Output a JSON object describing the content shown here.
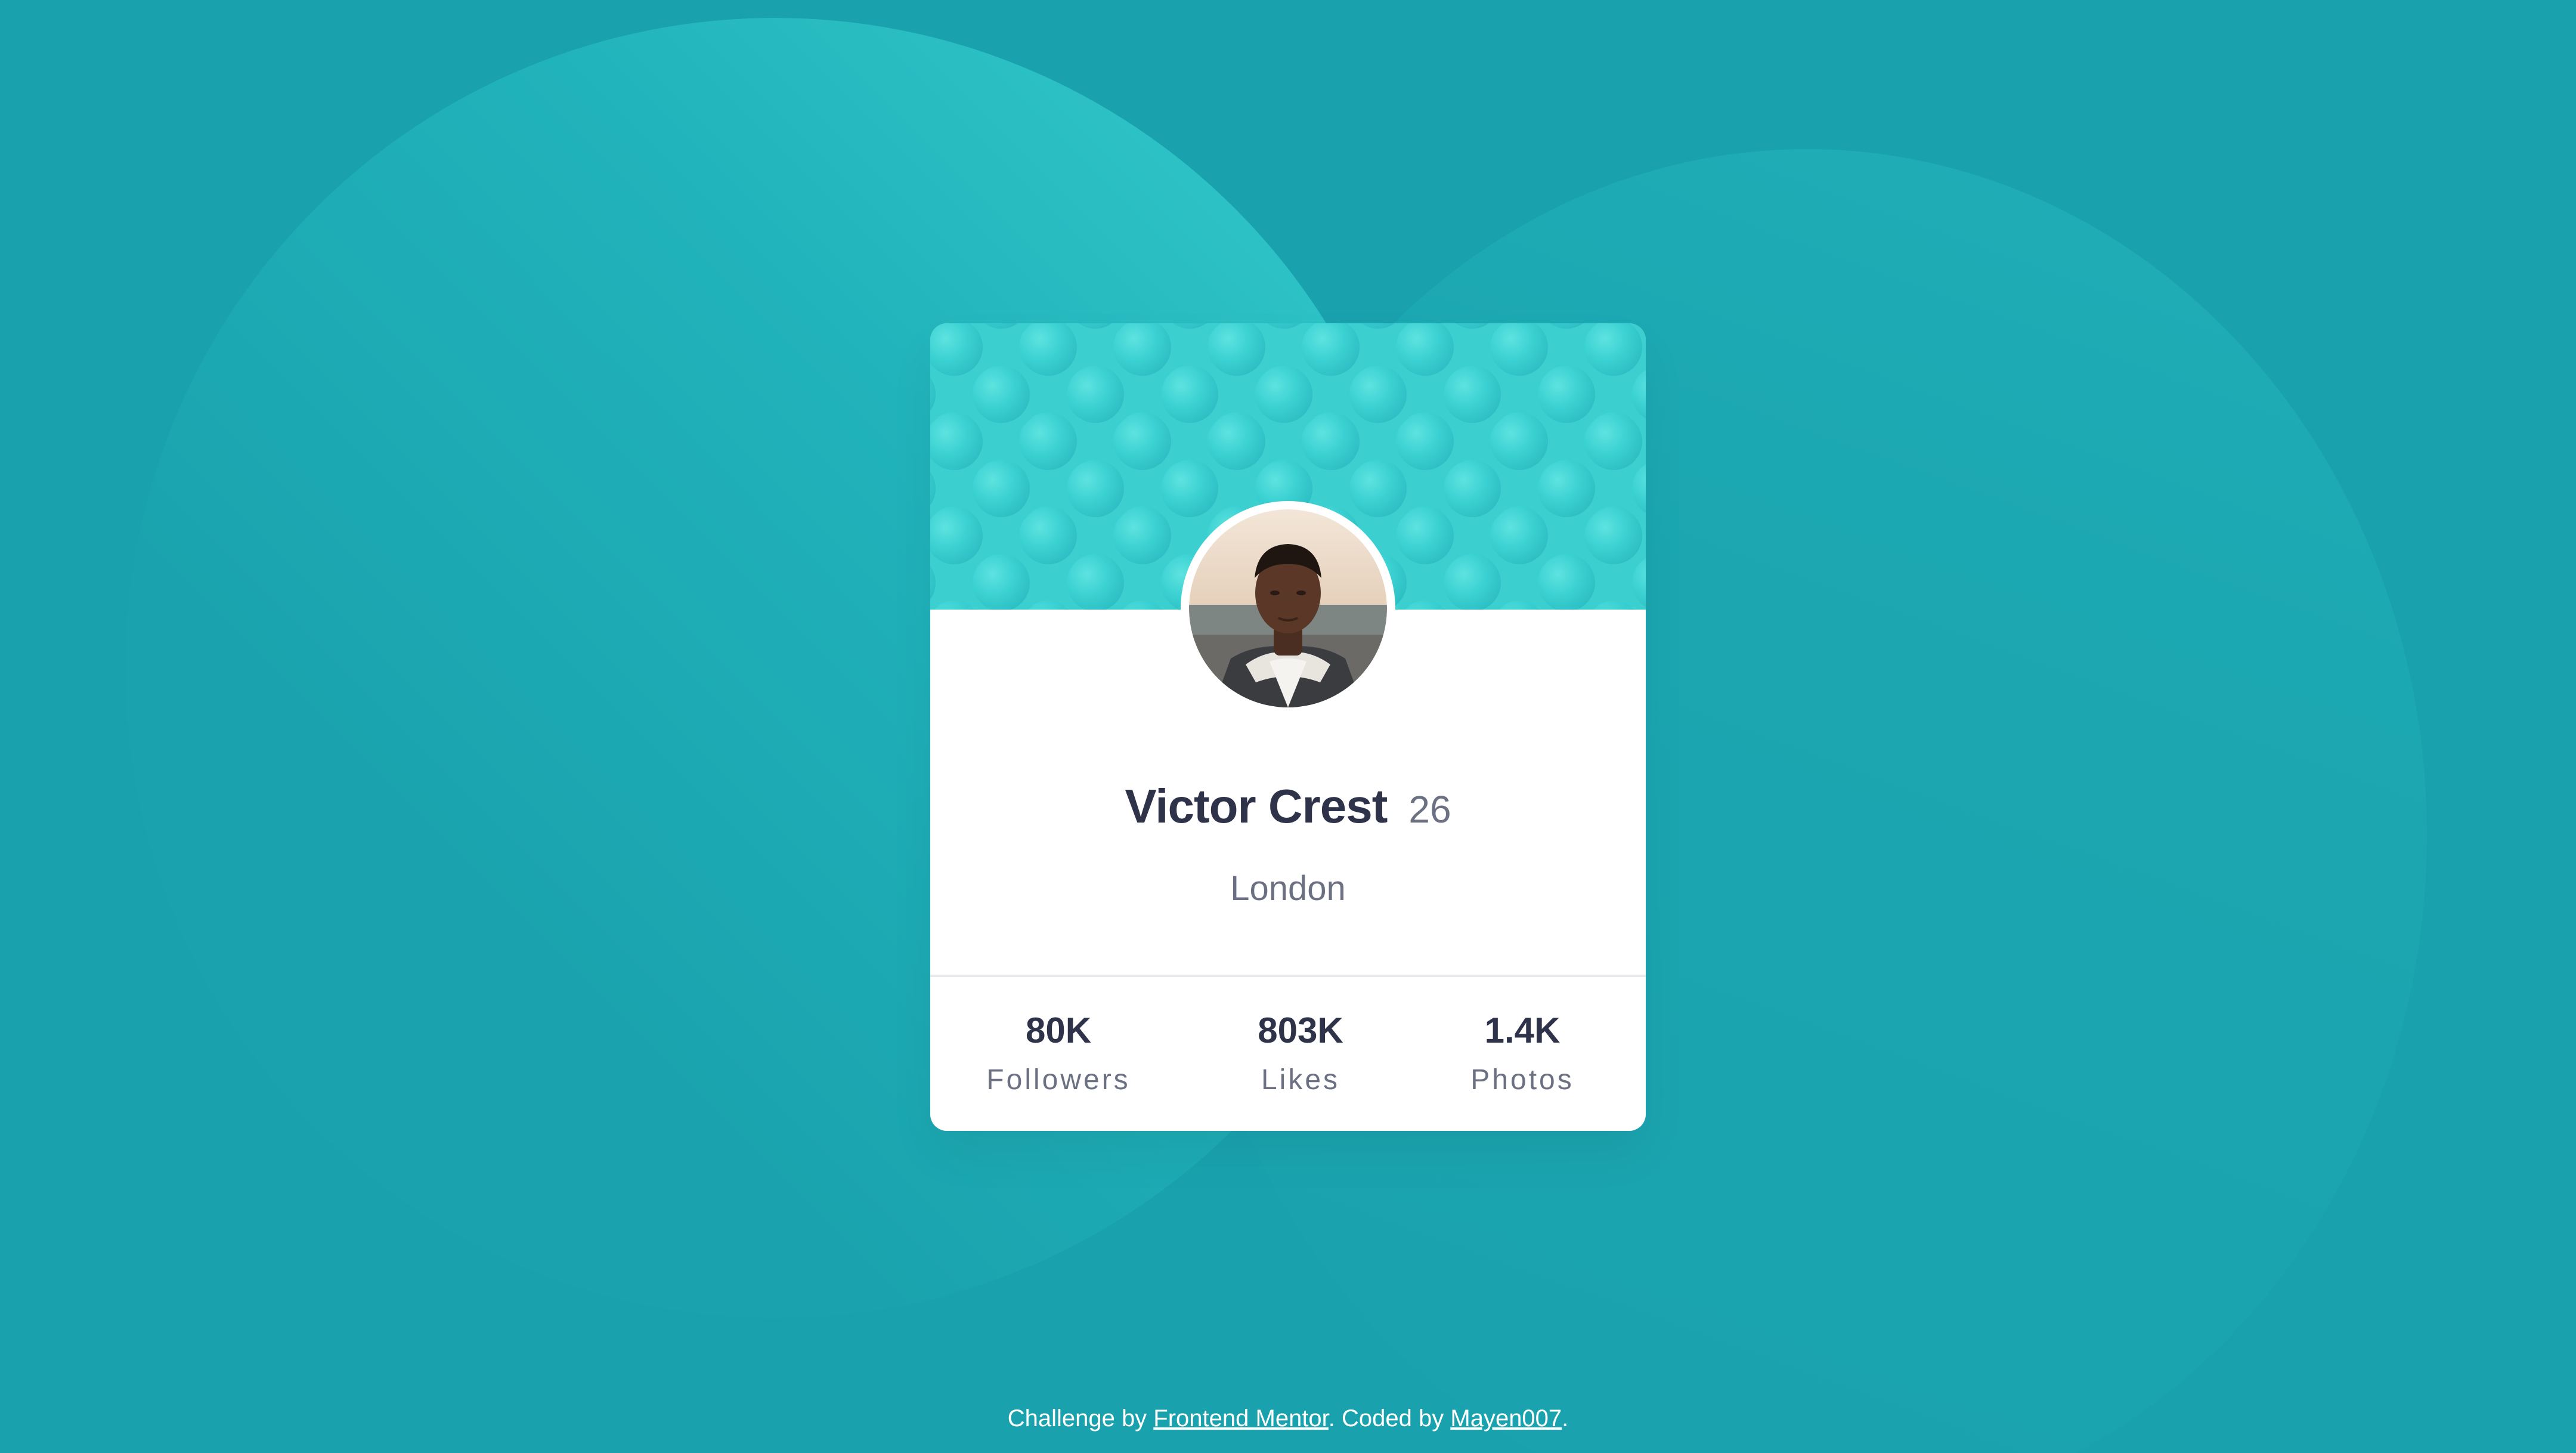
{
  "colors": {
    "background": "#19A2AE",
    "background_circle_light": "#35CCCC",
    "card": "#ffffff",
    "header_pattern": "#3CCFD0",
    "text_dark": "#2E3349",
    "text_gray": "#6B7082",
    "divider": "#E8E9EC"
  },
  "profile": {
    "name": "Victor Crest",
    "age": "26",
    "location": "London",
    "avatar_icon": "profile-photo"
  },
  "stats": [
    {
      "value": "80K",
      "label": "Followers"
    },
    {
      "value": "803K",
      "label": "Likes"
    },
    {
      "value": "1.4K",
      "label": "Photos"
    }
  ],
  "attribution": {
    "prefix": "Challenge by ",
    "challenge_link": "Frontend Mentor",
    "middle": ". Coded by ",
    "author_link": "Mayen007",
    "suffix": "."
  }
}
